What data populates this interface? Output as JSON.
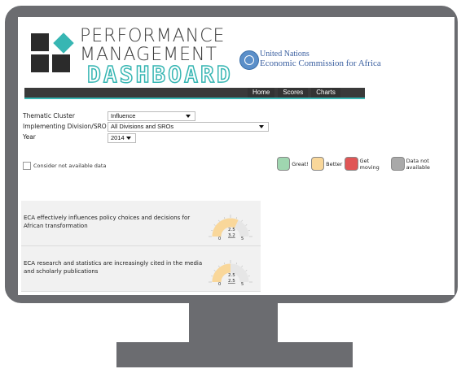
{
  "header": {
    "title_line1": "PERFORMANCE",
    "title_line2": "MANAGEMENT",
    "title_line3": "DASHBOARD",
    "un_line1": "United Nations",
    "un_line2": "Economic Commission for Africa",
    "nav": [
      "Home",
      "Scores",
      "Charts"
    ]
  },
  "filters": {
    "thematic_label": "Thematic Cluster",
    "thematic_value": "Influence",
    "division_label": "Implementing Division/SRO",
    "division_value": "All Divisions and SROs",
    "year_label": "Year",
    "year_value": "2014"
  },
  "consider_label": "Consider not available data",
  "legend": [
    {
      "label": "Great!",
      "color": "#9fd6b0"
    },
    {
      "label": "Better",
      "color": "#f9d79a"
    },
    {
      "label": "Get moving",
      "color": "#e05555"
    },
    {
      "label": "Data not available",
      "color": "#a9a9a9"
    }
  ],
  "indicators": [
    {
      "text": "ECA effectively influences policy choices and decisions for African transformation",
      "target": "2.5",
      "score": "3.2",
      "min": "0",
      "max": "5",
      "level": 0.64
    },
    {
      "text": "ECA research and statistics are increasingly cited in the media and scholarly publications",
      "target": "2.5",
      "score": "2.5",
      "min": "0",
      "max": "5",
      "level": 0.5
    }
  ],
  "colors": {
    "accent": "#37b6b3",
    "frame": "#6b6c70",
    "gauge_fill": "#f9d79a"
  }
}
